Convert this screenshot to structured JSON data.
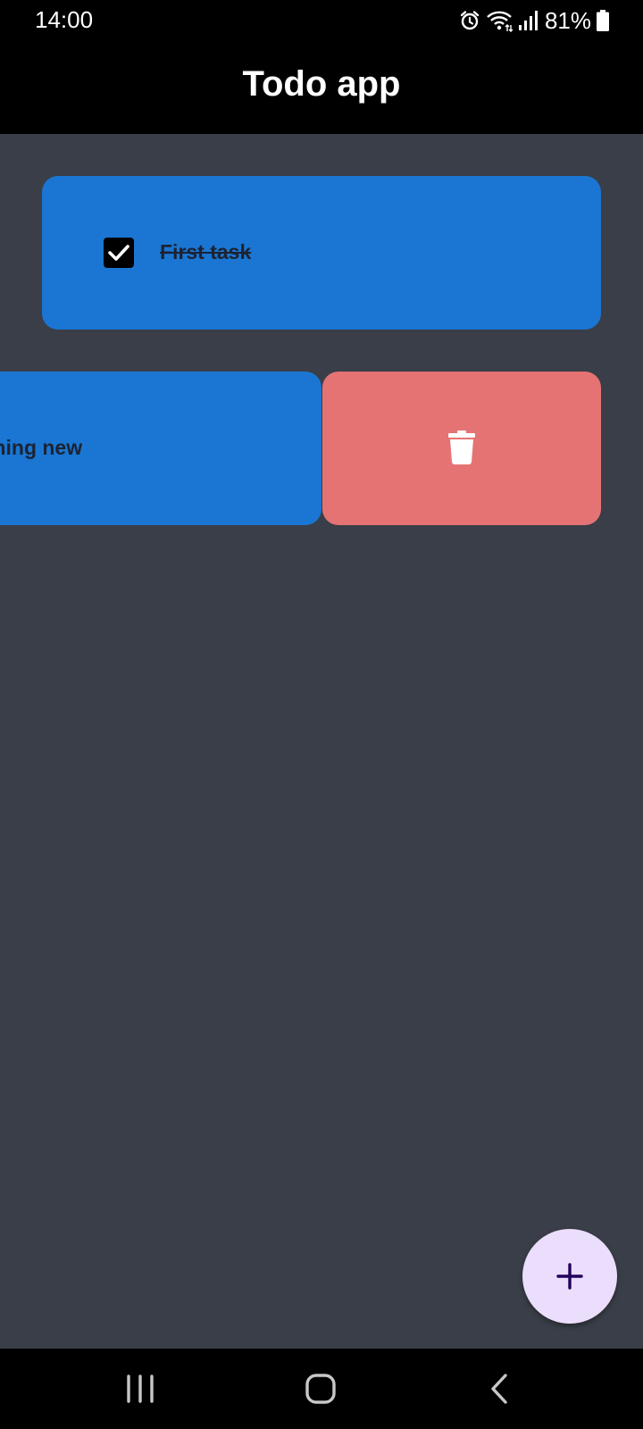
{
  "status_bar": {
    "time": "14:00",
    "battery": "81%",
    "icons": [
      "alarm-icon",
      "wifi-icon",
      "signal-icon",
      "battery-icon"
    ]
  },
  "app_bar": {
    "title": "Todo app"
  },
  "tasks": [
    {
      "text": "First task",
      "checked": true
    },
    {
      "text": "ething new",
      "checked": false
    }
  ],
  "swipe_action": {
    "icon": "trash-icon",
    "color": "#e57373"
  },
  "fab": {
    "icon": "plus-icon"
  },
  "nav_bar": {
    "buttons": [
      "recents-icon",
      "home-icon",
      "back-icon"
    ]
  },
  "colors": {
    "background": "#3a3e48",
    "card": "#1a76d2",
    "delete": "#e57373",
    "fab": "#ebddfc"
  }
}
